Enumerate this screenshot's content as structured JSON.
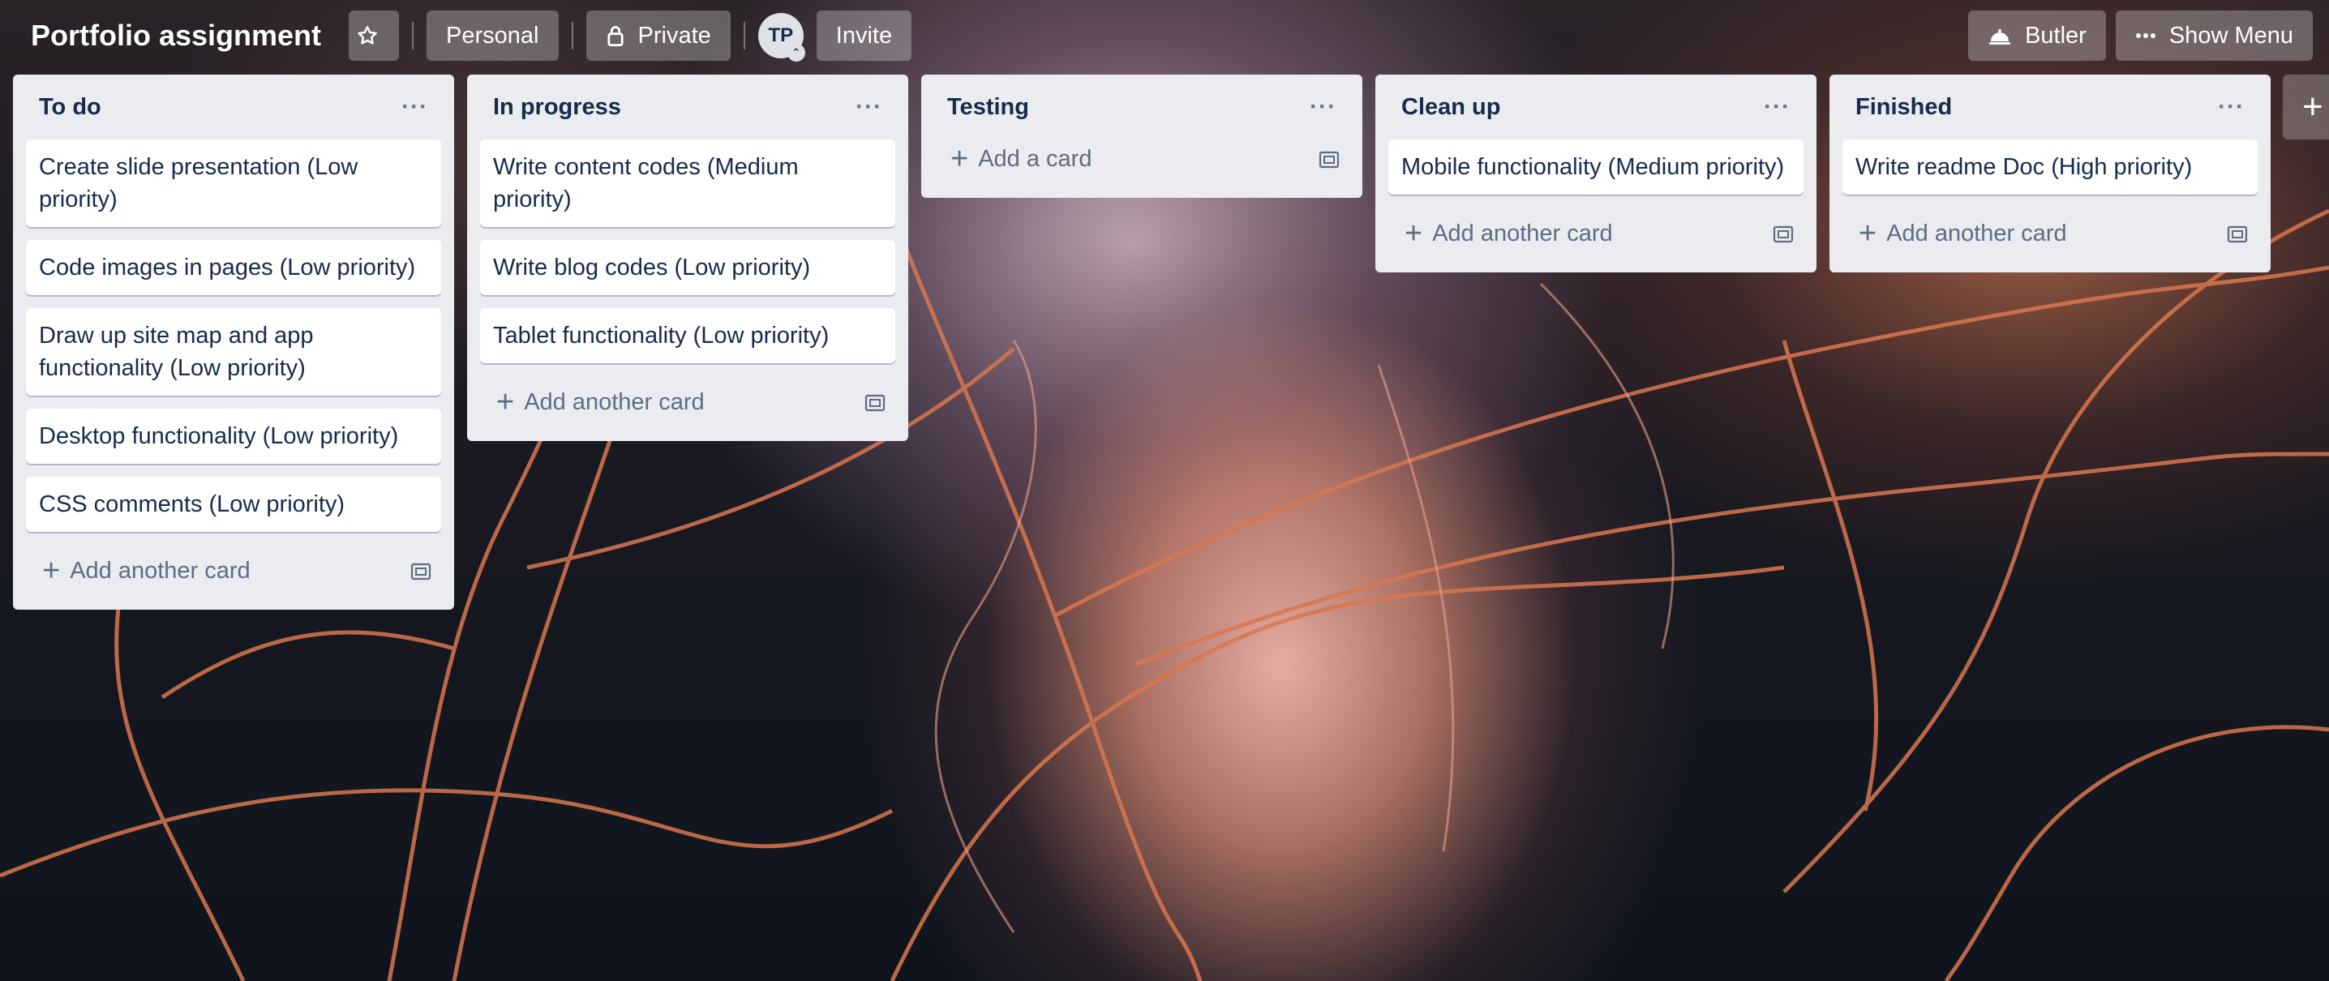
{
  "header": {
    "board_title": "Portfolio assignment",
    "star_icon": "star-icon",
    "team_label": "Personal",
    "visibility_label": "Private",
    "avatar_initials": "TP",
    "invite_label": "Invite",
    "butler_label": "Butler",
    "show_menu_label": "Show Menu"
  },
  "lists": [
    {
      "title": "To do",
      "cards": [
        "Create slide presentation (Low priority)",
        "Code images in pages (Low priority)",
        "Draw up site map and app functionality (Low priority)",
        "Desktop functionality (Low priority)",
        "CSS comments (Low priority)"
      ],
      "add_label": "Add another card"
    },
    {
      "title": "In progress",
      "cards": [
        "Write content codes (Medium priority)",
        "Write blog codes (Low priority)",
        "Tablet functionality (Low priority)"
      ],
      "add_label": "Add another card"
    },
    {
      "title": "Testing",
      "cards": [],
      "add_label": "Add a card"
    },
    {
      "title": "Clean up",
      "cards": [
        "Mobile functionality (Medium priority)"
      ],
      "add_label": "Add another card"
    },
    {
      "title": "Finished",
      "cards": [
        "Write readme Doc (High priority)"
      ],
      "add_label": "Add another card"
    }
  ],
  "colors": {
    "list_bg": "#ebecf0",
    "card_text": "#172b4d",
    "muted_text": "#5e6c84"
  }
}
